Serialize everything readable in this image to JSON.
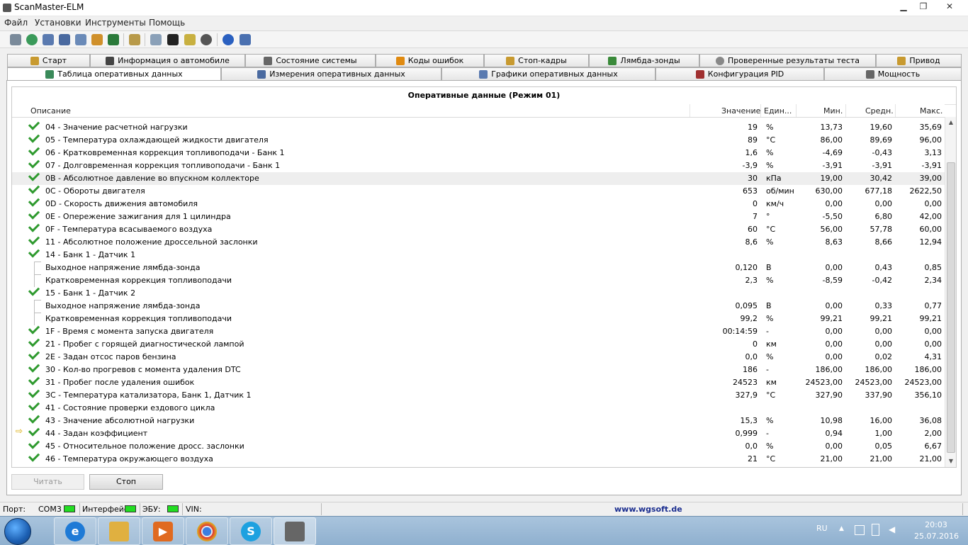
{
  "window": {
    "title": "ScanMaster-ELM",
    "minimize": "▁",
    "maximize": "❐",
    "close": "✕"
  },
  "menu": [
    "Файл",
    "Установки",
    "Инструменты",
    "Помощь"
  ],
  "tabs_top": [
    "Старт",
    "Информация о автомобиле",
    "Состояние системы",
    "Коды ошибок",
    "Стоп-кадры",
    "Лямбда-зонды",
    "Проверенные результаты теста",
    "Привод"
  ],
  "tabs_bottom": [
    "Таблица оперативных данных",
    "Измерения оперативных данных",
    "Графики оперативных данных",
    "Конфигурация PID",
    "Мощность"
  ],
  "active_tab": "Таблица оперативных данных",
  "grid": {
    "title": "Оперативные данные (Режим 01)",
    "headers": {
      "desc": "Описание",
      "value": "Значение",
      "unit": "Един...",
      "min": "Мин.",
      "avg": "Средн.",
      "max": "Макс."
    },
    "rows": [
      {
        "mark": "check",
        "desc": "04 - Значение расчетной нагрузки",
        "value": "19",
        "unit": "%",
        "min": "13,73",
        "avg": "19,60",
        "max": "35,69"
      },
      {
        "mark": "check",
        "desc": "05 - Температура охлаждающей жидкости двигателя",
        "value": "89",
        "unit": "°C",
        "min": "86,00",
        "avg": "89,69",
        "max": "96,00"
      },
      {
        "mark": "check",
        "desc": "06 - Кратковременная коррекция топливоподачи - Банк 1",
        "value": "1,6",
        "unit": "%",
        "min": "-4,69",
        "avg": "-0,43",
        "max": "3,13"
      },
      {
        "mark": "check",
        "desc": "07 - Долговременная коррекция топливоподачи - Банк 1",
        "value": "-3,9",
        "unit": "%",
        "min": "-3,91",
        "avg": "-3,91",
        "max": "-3,91"
      },
      {
        "mark": "check",
        "sel": true,
        "desc": "0B - Абсолютное давление во впускном коллекторе",
        "value": "30",
        "unit": "кПа",
        "min": "19,00",
        "avg": "30,42",
        "max": "39,00"
      },
      {
        "mark": "check",
        "desc": "0C - Обороты двигателя",
        "value": "653",
        "unit": "об/мин",
        "min": "630,00",
        "avg": "677,18",
        "max": "2622,50"
      },
      {
        "mark": "check",
        "desc": "0D - Скорость движения автомобиля",
        "value": "0",
        "unit": "км/ч",
        "min": "0,00",
        "avg": "0,00",
        "max": "0,00"
      },
      {
        "mark": "check",
        "desc": "0E - Опережение зажигания для 1 цилиндра",
        "value": "7",
        "unit": "°",
        "min": "-5,50",
        "avg": "6,80",
        "max": "42,00"
      },
      {
        "mark": "check",
        "desc": "0F - Температура всасываемого воздуха",
        "value": "60",
        "unit": "°C",
        "min": "56,00",
        "avg": "57,78",
        "max": "60,00"
      },
      {
        "mark": "check",
        "desc": "11 - Абсолютное положение дроссельной заслонки",
        "value": "8,6",
        "unit": "%",
        "min": "8,63",
        "avg": "8,66",
        "max": "12,94"
      },
      {
        "mark": "check",
        "desc": "14 - Банк 1 - Датчик 1",
        "value": "",
        "unit": "",
        "min": "",
        "avg": "",
        "max": ""
      },
      {
        "mark": "sub",
        "desc": "Выходное напряжение лямбда-зонда",
        "value": "0,120",
        "unit": "В",
        "min": "0,00",
        "avg": "0,43",
        "max": "0,85"
      },
      {
        "mark": "sub",
        "desc": "Кратковременная коррекция топливоподачи",
        "value": "2,3",
        "unit": "%",
        "min": "-8,59",
        "avg": "-0,42",
        "max": "2,34"
      },
      {
        "mark": "check",
        "desc": "15 - Банк 1 - Датчик 2",
        "value": "",
        "unit": "",
        "min": "",
        "avg": "",
        "max": ""
      },
      {
        "mark": "sub",
        "desc": "Выходное напряжение лямбда-зонда",
        "value": "0,095",
        "unit": "В",
        "min": "0,00",
        "avg": "0,33",
        "max": "0,77"
      },
      {
        "mark": "sub",
        "desc": "Кратковременная коррекция топливоподачи",
        "value": "99,2",
        "unit": "%",
        "min": "99,21",
        "avg": "99,21",
        "max": "99,21"
      },
      {
        "mark": "check",
        "desc": "1F - Время с момента запуска двигателя",
        "value": "00:14:59",
        "unit": "-",
        "min": "0,00",
        "avg": "0,00",
        "max": "0,00"
      },
      {
        "mark": "check",
        "desc": "21 - Пробег с горящей диагностической лампой",
        "value": "0",
        "unit": "км",
        "min": "0,00",
        "avg": "0,00",
        "max": "0,00"
      },
      {
        "mark": "check",
        "desc": "2E - Задан отсос паров бензина",
        "value": "0,0",
        "unit": "%",
        "min": "0,00",
        "avg": "0,02",
        "max": "4,31"
      },
      {
        "mark": "check",
        "desc": "30 - Кол-во прогревов с момента удаления DTC",
        "value": "186",
        "unit": "-",
        "min": "186,00",
        "avg": "186,00",
        "max": "186,00"
      },
      {
        "mark": "check",
        "desc": "31 - Пробег после удаления ошибок",
        "value": "24523",
        "unit": "км",
        "min": "24523,00",
        "avg": "24523,00",
        "max": "24523,00"
      },
      {
        "mark": "check",
        "desc": "3C - Температура катализатора, Банк 1, Датчик 1",
        "value": "327,9",
        "unit": "°C",
        "min": "327,90",
        "avg": "337,90",
        "max": "356,10"
      },
      {
        "mark": "check",
        "desc": "41 - Состояние проверки ездового цикла",
        "value": "",
        "unit": "",
        "min": "",
        "avg": "",
        "max": ""
      },
      {
        "mark": "check",
        "desc": "43 - Значение абсолютной нагрузки",
        "value": "15,3",
        "unit": "%",
        "min": "10,98",
        "avg": "16,00",
        "max": "36,08"
      },
      {
        "mark": "check",
        "arrow": true,
        "desc": "44 - Задан коэффициент",
        "value": "0,999",
        "unit": "-",
        "min": "0,94",
        "avg": "1,00",
        "max": "2,00"
      },
      {
        "mark": "check",
        "desc": "45 - Относительное положение дросс. заслонки",
        "value": "0,0",
        "unit": "%",
        "min": "0,00",
        "avg": "0,05",
        "max": "6,67"
      },
      {
        "mark": "check",
        "desc": "46 - Температура окружающего воздуха",
        "value": "21",
        "unit": "°C",
        "min": "21,00",
        "avg": "21,00",
        "max": "21,00"
      }
    ]
  },
  "buttons": {
    "read": "Читать",
    "stop": "Стоп"
  },
  "status": {
    "port_label": "Порт:",
    "port_value": "COM3",
    "interface_label": "Интерфейс:",
    "ecu_label": "ЭБУ:",
    "vin_label": "VIN:",
    "site": "www.wgsoft.de"
  },
  "taskbar": {
    "lang": "RU",
    "time": "20:03",
    "date": "25.07.2016"
  },
  "colors": {
    "check": "#2f9a2f",
    "led": "#22dd22",
    "link": "#1a2d8f",
    "arrow": "#d9a800"
  }
}
